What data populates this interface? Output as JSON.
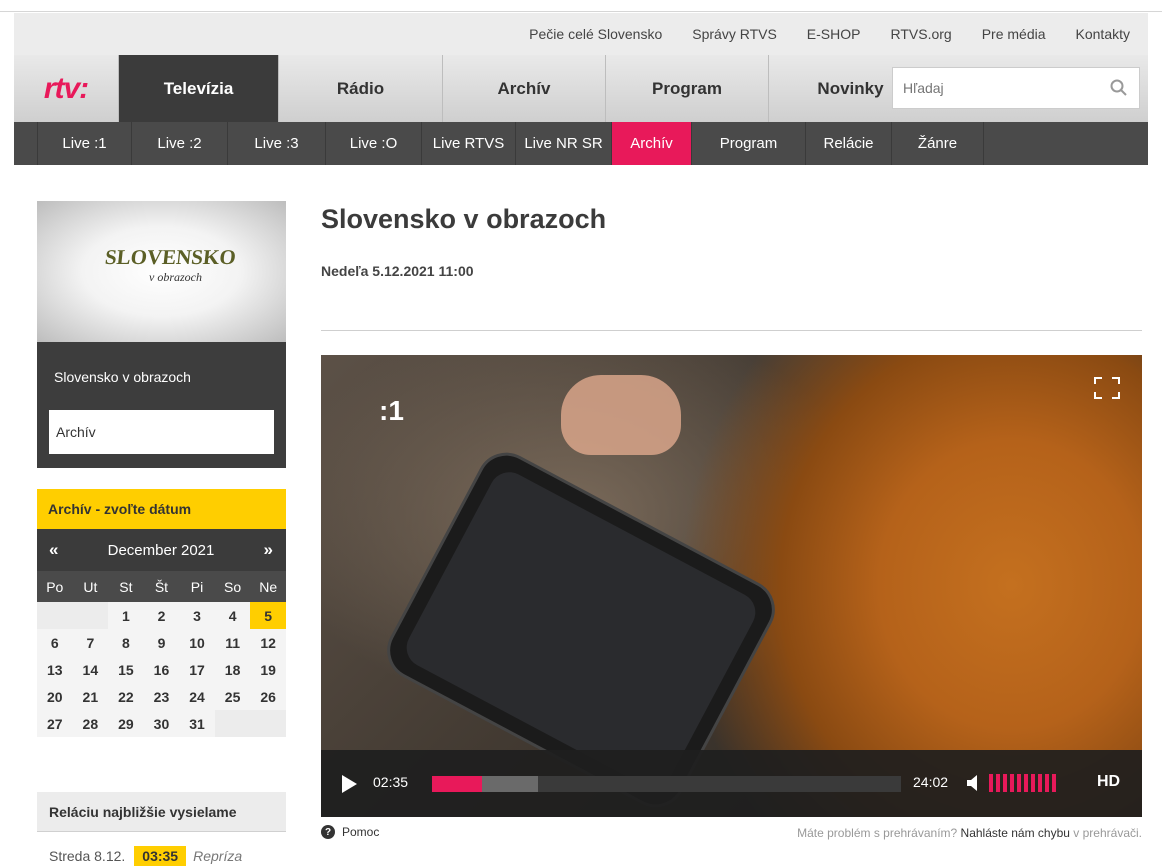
{
  "utility_links": [
    "Pečie celé Slovensko",
    "Správy RTVS",
    "E-SHOP",
    "RTVS.org",
    "Pre média",
    "Kontakty"
  ],
  "logo": "rtv:",
  "main_tabs": [
    {
      "label": "Televízia",
      "active": true
    },
    {
      "label": "Rádio",
      "active": false
    },
    {
      "label": "Archív",
      "active": false
    },
    {
      "label": "Program",
      "active": false
    },
    {
      "label": "Novinky",
      "active": false
    }
  ],
  "search": {
    "placeholder": "Hľadaj",
    "icon": "search-icon"
  },
  "sub_tabs": [
    {
      "label": "Live :1",
      "active": false
    },
    {
      "label": "Live :2",
      "active": false
    },
    {
      "label": "Live :3",
      "active": false
    },
    {
      "label": "Live :O",
      "active": false
    },
    {
      "label": "Live RTVS",
      "active": false
    },
    {
      "label": "Live NR SR",
      "active": false
    },
    {
      "label": "Archív",
      "active": true
    },
    {
      "label": "Program",
      "active": false
    },
    {
      "label": "Relácie",
      "active": false
    },
    {
      "label": "Žánre",
      "active": false
    }
  ],
  "show_card": {
    "logo_line1": "SLOVENSKO",
    "logo_line2": "v obrazoch",
    "name": "Slovensko v obrazoch",
    "archive_label": "Archív"
  },
  "calendar": {
    "header": "Archív - zvoľte dátum",
    "month": "December 2021",
    "prev": "«",
    "next": "»",
    "weekdays": [
      "Po",
      "Ut",
      "St",
      "Št",
      "Pi",
      "So",
      "Ne"
    ],
    "weeks": [
      [
        "",
        "",
        "1",
        "2",
        "3",
        "4",
        "5"
      ],
      [
        "6",
        "7",
        "8",
        "9",
        "10",
        "11",
        "12"
      ],
      [
        "13",
        "14",
        "15",
        "16",
        "17",
        "18",
        "19"
      ],
      [
        "20",
        "21",
        "22",
        "23",
        "24",
        "25",
        "26"
      ],
      [
        "27",
        "28",
        "29",
        "30",
        "31",
        "",
        ""
      ]
    ],
    "selected_day": "5"
  },
  "next_broadcast": {
    "header": "Reláciu najbližšie vysielame",
    "day": "Streda 8.12.",
    "time": "03:35",
    "note": "Repríza"
  },
  "content": {
    "title": "Slovensko v obrazoch",
    "date": "Nedeľa 5.12.2021 11:00"
  },
  "player": {
    "channel_logo": ":1",
    "current_time": "02:35",
    "duration": "24:02",
    "progress_fraction": 0.107,
    "buffered_fraction": 0.225,
    "volume_bars": 10,
    "hd_label": "HD",
    "fullscreen_icon": "fullscreen-icon",
    "play_icon": "play-icon",
    "volume_icon": "volume-icon"
  },
  "help": {
    "label": "Pomoc",
    "problem_text": "Máte problém s prehrávaním?",
    "report_link": "Nahláste nám chybu",
    "suffix": "v prehrávači."
  },
  "colors": {
    "accent": "#e8195a",
    "highlight": "#ffce00",
    "dark": "#3b3b3b"
  }
}
